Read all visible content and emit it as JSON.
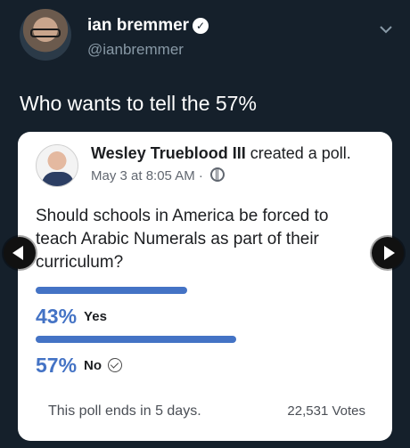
{
  "tweet": {
    "author_name": "ian bremmer",
    "author_handle": "@ianbremmer",
    "text": "Who wants to tell the 57%"
  },
  "embed": {
    "poster_name": "Wesley Trueblood III",
    "poster_action": "created a poll.",
    "timestamp": "May 3 at 8:05 AM",
    "meta_separator": "·",
    "question": "Should schools in America be forced to teach Arabic Numerals as part of their curriculum?",
    "options": [
      {
        "percent_label": "43%",
        "label": "Yes",
        "share": 0.43,
        "selected": false
      },
      {
        "percent_label": "57%",
        "label": "No",
        "share": 0.57,
        "selected": true
      }
    ],
    "ends_text": "This poll ends in 5 days.",
    "votes_text": "22,531 Votes"
  },
  "colors": {
    "background": "#15202b",
    "accent": "#4473c5",
    "card": "#ffffff"
  },
  "icons": [
    "verified-badge-icon",
    "chevron-down-icon",
    "globe-icon",
    "check-circle-icon",
    "previous-arrow-icon",
    "next-arrow-icon"
  ]
}
